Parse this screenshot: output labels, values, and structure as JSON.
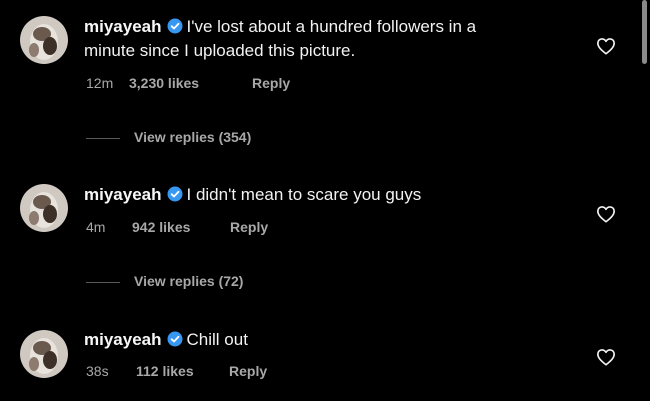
{
  "colors": {
    "background": "#000000",
    "primary_text": "#f2f2f2",
    "secondary_text": "#a8a8a8",
    "verified_badge": "#3897f0"
  },
  "comments": [
    {
      "username": "miyayeah",
      "text_line1": "I've lost about a hundred followers in a",
      "text_line2": "minute since I uploaded this picture.",
      "time": "12m",
      "likes": "3,230 likes",
      "reply": "Reply",
      "view_replies": "View replies (354)",
      "avatar_icon": "avatar-image",
      "heart_icon": "heart-outline-icon"
    },
    {
      "username": "miyayeah",
      "text_line1": "I didn't mean to scare you guys",
      "time": "4m",
      "likes": "942 likes",
      "reply": "Reply",
      "view_replies": "View replies (72)",
      "avatar_icon": "avatar-image",
      "heart_icon": "heart-outline-icon"
    },
    {
      "username": "miyayeah",
      "text_line1": "Chill out",
      "time": "38s",
      "likes": "112 likes",
      "reply": "Reply",
      "avatar_icon": "avatar-image",
      "heart_icon": "heart-outline-icon"
    }
  ]
}
